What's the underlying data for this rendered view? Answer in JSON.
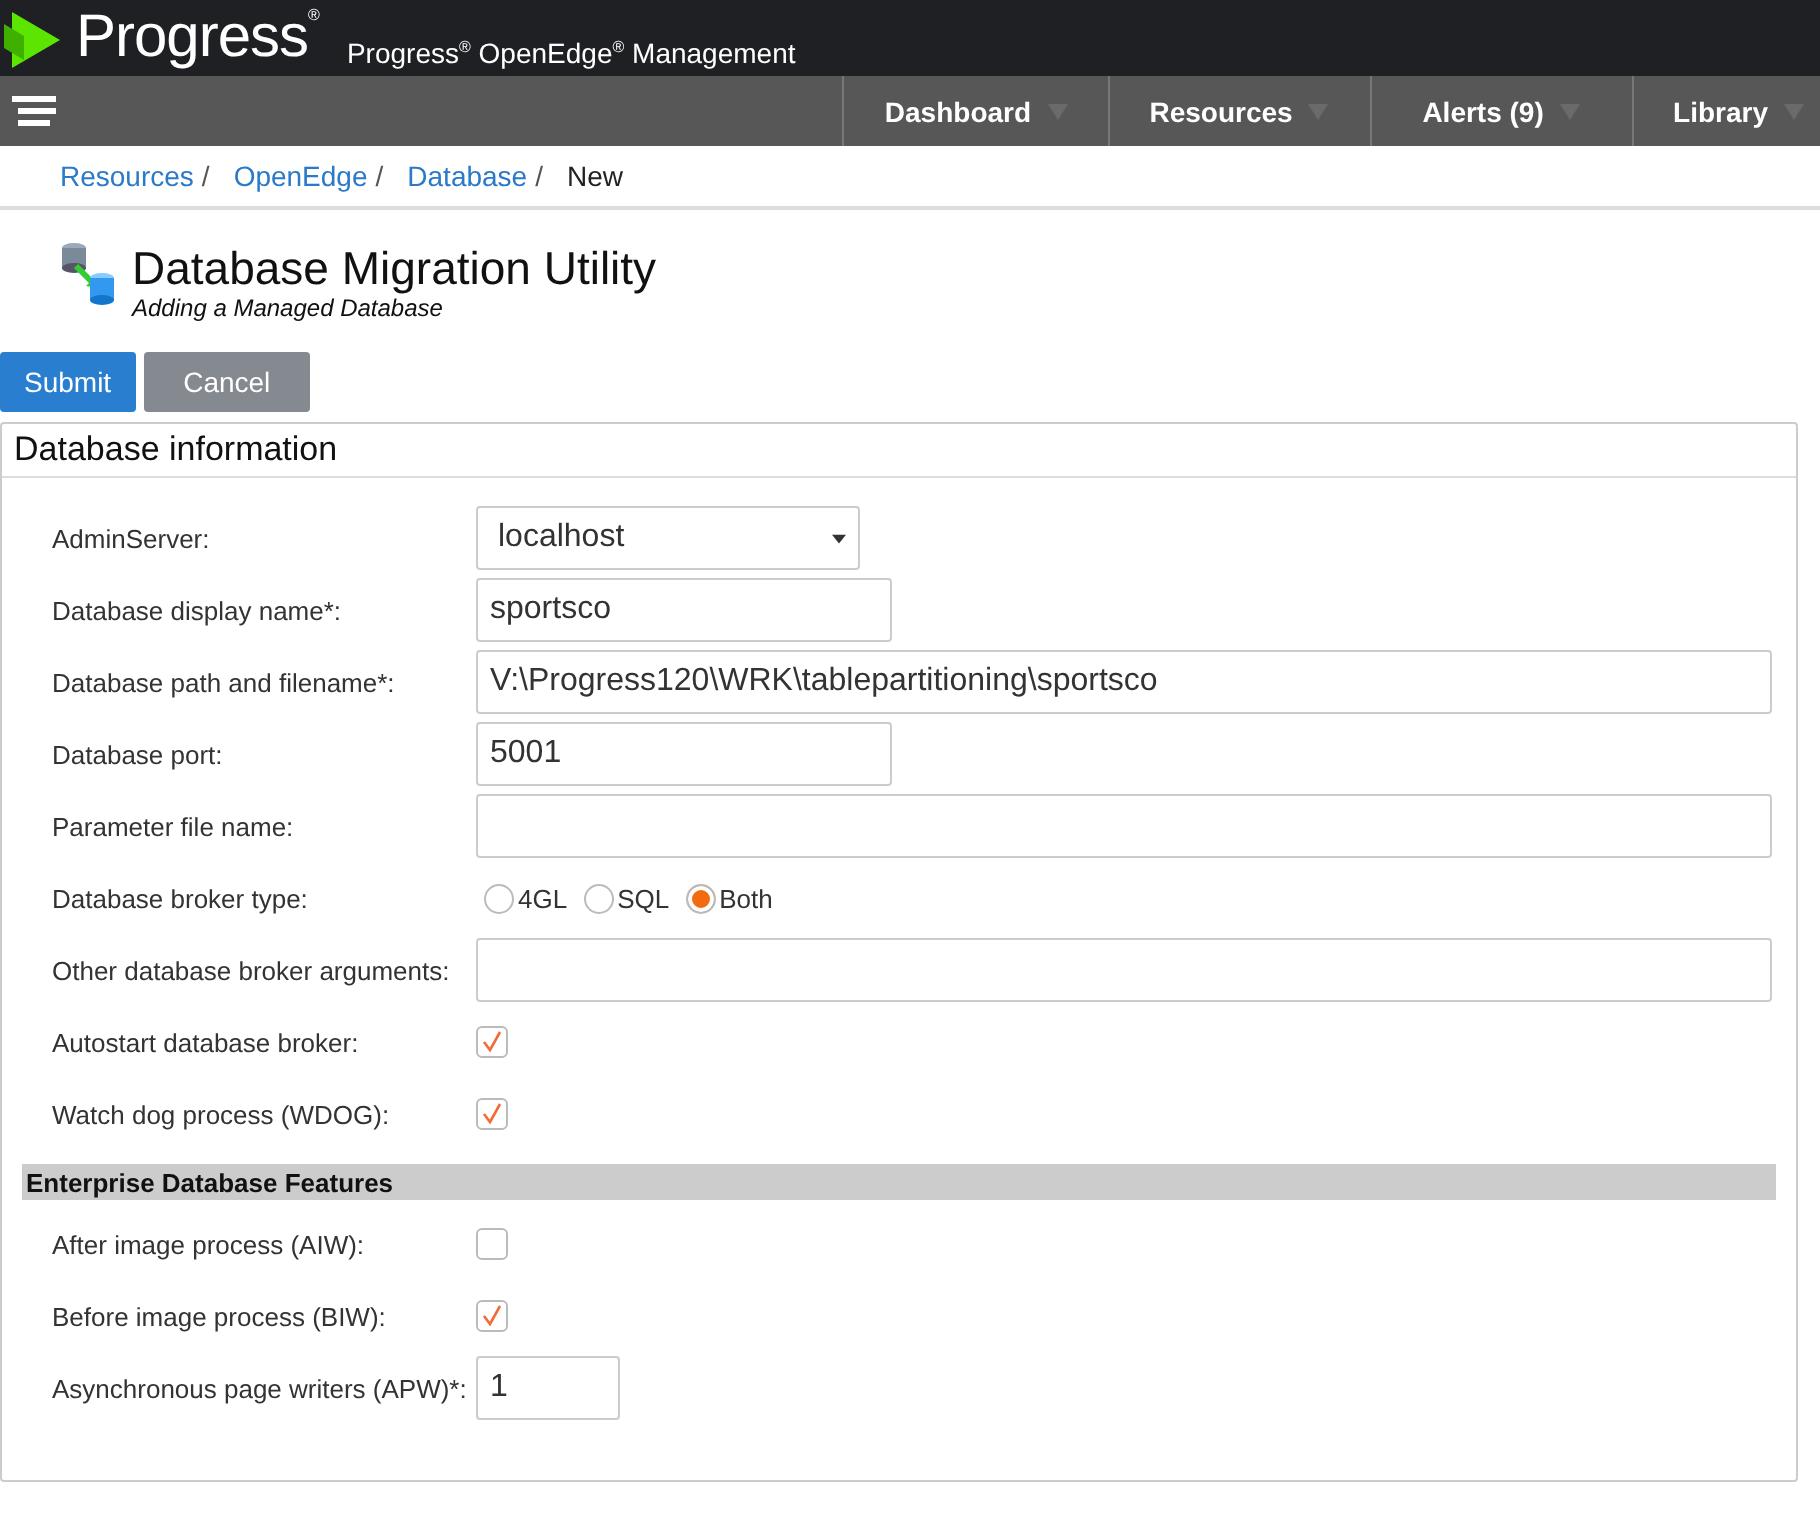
{
  "header": {
    "brand": "Progress",
    "brand_mark": "®",
    "product": "Progress$^{®}$ OpenEdge$^{®}$ Management"
  },
  "nav": [
    {
      "label": "Dashboard"
    },
    {
      "label": "Resources"
    },
    {
      "label": "Alerts (9)"
    },
    {
      "label": "Library"
    }
  ],
  "breadcrumb": [
    {
      "label": "Resources",
      "link": true,
      "separator": "/"
    },
    {
      "label": "OpenEdge",
      "link": true,
      "separator": "/"
    },
    {
      "label": "Database",
      "link": true,
      "separator": "/"
    },
    {
      "label": "New",
      "link": false
    }
  ],
  "page": {
    "title": "Database Migration Utility",
    "subtitle": "Adding a Managed Database"
  },
  "buttons": [
    {
      "label": "Submit",
      "kind": "primary"
    },
    {
      "label": "Cancel",
      "kind": "secondary"
    }
  ],
  "panel": {
    "title": "Database information",
    "fields": [
      {
        "kind": "select",
        "label": "AdminServer:",
        "value": "localhost"
      },
      {
        "kind": "text",
        "label": "Database display name*:",
        "value": "sportsco"
      },
      {
        "kind": "widetext",
        "label": "Database path and filename*:",
        "value": "V:\\Progress120\\WRK\\tablepartitioning\\sportsco"
      },
      {
        "kind": "text",
        "label": "Database port:",
        "value": "5001"
      },
      {
        "kind": "widetext",
        "label": "Parameter file name:"
      },
      {
        "kind": "radio",
        "label": "Database broker type:",
        "options": [
          {
            "label": "4GL",
            "selected": false
          },
          {
            "label": "SQL",
            "selected": false
          },
          {
            "label": "Both",
            "selected": true
          }
        ]
      },
      {
        "kind": "widetext",
        "label": "Other database broker arguments:"
      },
      {
        "kind": "checkbox",
        "label": "Autostart database broker:",
        "checked": true
      },
      {
        "kind": "checkbox",
        "label": "Watch dog process (WDOG):",
        "checked": true
      }
    ],
    "section": {
      "title": "Enterprise Database Features",
      "fields": [
        {
          "kind": "checkbox",
          "label": "After image process (AIW):",
          "checked": false
        },
        {
          "kind": "checkbox",
          "label": "Before image process (BIW):",
          "checked": true
        },
        {
          "kind": "smalltext",
          "label": "Asynchronous page writers (APW)*:",
          "value": "1"
        }
      ]
    }
  }
}
